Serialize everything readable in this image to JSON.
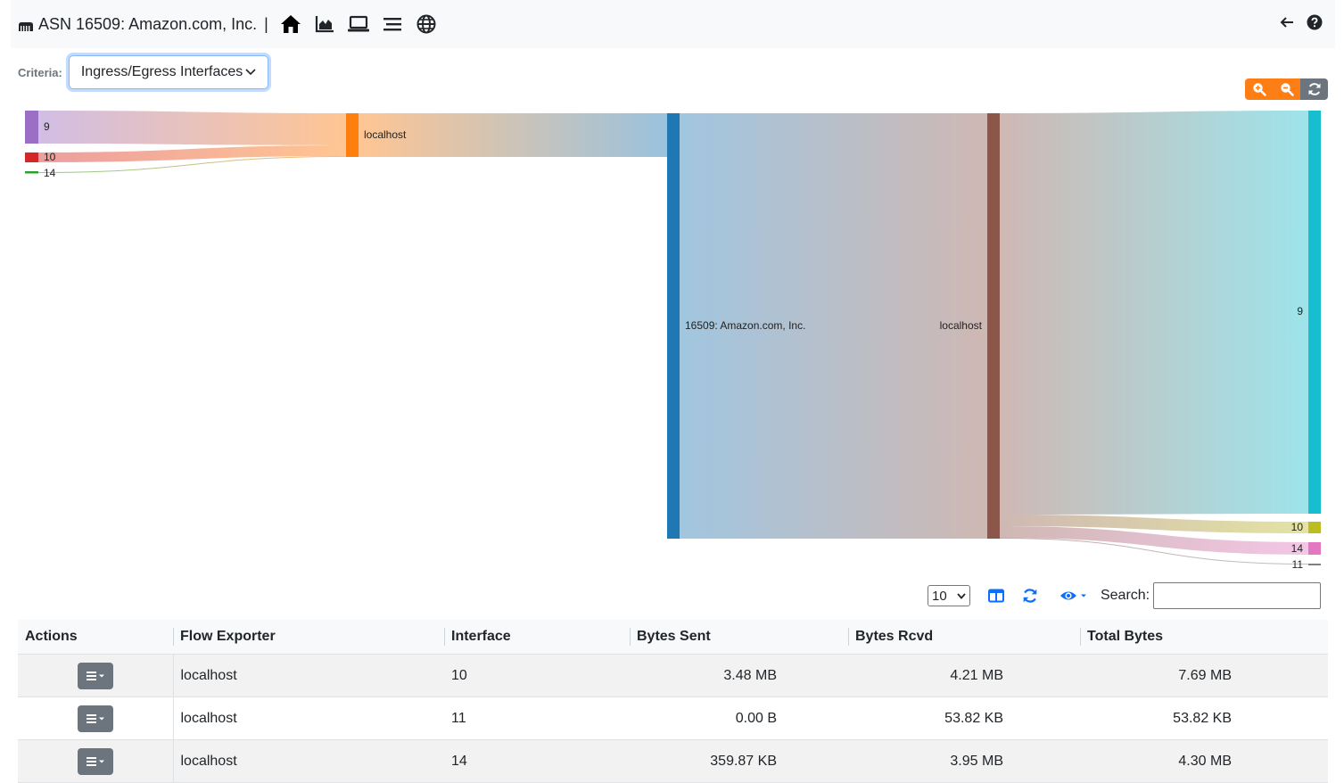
{
  "header": {
    "title": "ASN 16509: Amazon.com, Inc.",
    "separator": "|",
    "nav_icons": [
      "home-icon",
      "area-chart-icon",
      "laptop-icon",
      "list-icon",
      "globe-icon"
    ],
    "right_icons": [
      "arrow-left-icon",
      "question-circle-icon"
    ]
  },
  "criteria": {
    "label": "Criteria:",
    "selected": "Ingress/Egress Interfaces"
  },
  "zoom_buttons": [
    "zoom-in-icon",
    "zoom-out-icon",
    "reset-icon"
  ],
  "sankey": {
    "nodes": [
      {
        "id": "in9",
        "label": "9",
        "color": "#9a6fc4"
      },
      {
        "id": "in10",
        "label": "10",
        "color": "#d62728"
      },
      {
        "id": "in14",
        "label": "14",
        "color": "#2ca02c"
      },
      {
        "id": "exp1",
        "label": "localhost",
        "color": "#ff7f0e"
      },
      {
        "id": "asn",
        "label": "16509: Amazon.com, Inc.",
        "color": "#1f77b4"
      },
      {
        "id": "exp2",
        "label": "localhost",
        "color": "#8c564b"
      },
      {
        "id": "out9",
        "label": "9",
        "color": "#17becf"
      },
      {
        "id": "out10",
        "label": "10",
        "color": "#bcbd22"
      },
      {
        "id": "out14",
        "label": "14",
        "color": "#e377c2"
      },
      {
        "id": "out11",
        "label": "11",
        "color": "#7f7f7f"
      }
    ]
  },
  "table_controls": {
    "page_length": "10",
    "search_label": "Search:",
    "icons": [
      "columns-icon",
      "refresh-icon",
      "eye-icon"
    ]
  },
  "table": {
    "headers": [
      "Actions",
      "Flow Exporter",
      "Interface",
      "Bytes Sent",
      "Bytes Rcvd",
      "Total Bytes"
    ],
    "rows": [
      {
        "exporter": "localhost",
        "interface": "10",
        "sent": "3.48 MB",
        "rcvd": "4.21 MB",
        "total": "7.69 MB"
      },
      {
        "exporter": "localhost",
        "interface": "11",
        "sent": "0.00 B",
        "rcvd": "53.82 KB",
        "total": "53.82 KB"
      },
      {
        "exporter": "localhost",
        "interface": "14",
        "sent": "359.87 KB",
        "rcvd": "3.95 MB",
        "total": "4.30 MB"
      }
    ]
  }
}
